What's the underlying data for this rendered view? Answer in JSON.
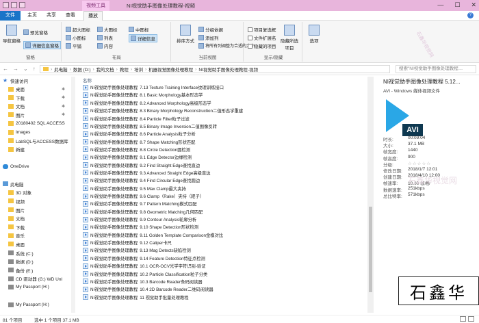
{
  "titlebar": {
    "context_tab": "视频工具",
    "title": "NI视觉助手图像处理教程-视频",
    "minimize": "—",
    "maximize": "☐",
    "close": "✕"
  },
  "tabs": {
    "file": "文件",
    "home": "主页",
    "share": "共享",
    "view": "查看",
    "play": "播放"
  },
  "ribbon": {
    "pane": {
      "nav_pane": "导航窗格",
      "preview": "预览窗格",
      "details": "详细信息窗格",
      "label": "窗格"
    },
    "layout": {
      "xl_icons": "超大图标",
      "large_icons": "大图标",
      "medium_icons": "中图标",
      "small_icons": "小图标",
      "list": "列表",
      "details": "详细信息",
      "tiles": "平铺",
      "content": "内容",
      "label": "布局"
    },
    "view": {
      "sort": "排序方式",
      "group_by": "分组依据",
      "add_columns": "添加列",
      "fit_columns": "将所有列调整为合适的大小",
      "label": "当前视图"
    },
    "showhide": {
      "checkboxes": "项目复选框",
      "extensions": "文件扩展名",
      "hidden": "隐藏的项目",
      "hide_selected": "隐藏所选项目",
      "label": "显示/隐藏"
    },
    "options": "选项"
  },
  "address": {
    "path": [
      "此电脑",
      "数据 (D:)",
      "我的文档",
      "教程",
      "培训",
      "机器视觉图像处理教程",
      "NI视觉助手图像处理教程-视频"
    ],
    "search_placeholder": "搜索\"NI视觉助手图像处理教程…"
  },
  "nav": [
    {
      "label": "快速访问",
      "type": "star",
      "pinned": false
    },
    {
      "label": "桌面",
      "type": "fold",
      "pinned": true
    },
    {
      "label": "下载",
      "type": "fold",
      "pinned": true
    },
    {
      "label": "文档",
      "type": "fold",
      "pinned": true
    },
    {
      "label": "图片",
      "type": "fold",
      "pinned": true
    },
    {
      "label": "20180402 SQL ACCESS",
      "type": "fold",
      "pinned": false
    },
    {
      "label": "Images",
      "type": "fold",
      "pinned": false
    },
    {
      "label": "LabSQL与ACCESS数据库",
      "type": "fold",
      "pinned": false
    },
    {
      "label": "新建",
      "type": "fold",
      "pinned": false
    },
    {
      "label": "",
      "type": "",
      "pinned": false
    },
    {
      "label": "OneDrive",
      "type": "cloud",
      "pinned": false
    },
    {
      "label": "",
      "type": "",
      "pinned": false
    },
    {
      "label": "此电脑",
      "type": "pc",
      "pinned": false
    },
    {
      "label": "3D 对象",
      "type": "fold",
      "pinned": false
    },
    {
      "label": "视频",
      "type": "fold",
      "pinned": false
    },
    {
      "label": "图片",
      "type": "fold",
      "pinned": false
    },
    {
      "label": "文档",
      "type": "fold",
      "pinned": false
    },
    {
      "label": "下载",
      "type": "fold",
      "pinned": false
    },
    {
      "label": "音乐",
      "type": "fold",
      "pinned": false
    },
    {
      "label": "桌面",
      "type": "fold",
      "pinned": false
    },
    {
      "label": "系统 (C:)",
      "type": "drv",
      "pinned": false
    },
    {
      "label": "数据 (D:)",
      "type": "drv",
      "pinned": false
    },
    {
      "label": "备份 (E:)",
      "type": "drv",
      "pinned": false
    },
    {
      "label": "CD 驱动器 (G:) WD Unl",
      "type": "drv",
      "pinned": false
    },
    {
      "label": "My Passport (H:)",
      "type": "drv",
      "pinned": false
    },
    {
      "label": "",
      "type": "",
      "pinned": false
    },
    {
      "label": "My Passport (H:)",
      "type": "drv",
      "pinned": false
    }
  ],
  "list": {
    "header": "名称",
    "prefix": "NI视觉助手图像处理教程",
    "items": [
      "7.13 Texture Training Interface纹理训练接口",
      "8.1 Basic Morphology基本形态学",
      "8.2 Advanced Morphology高级形态学",
      "8.3 Binary Morphology Reconstruction二值形态学重建",
      "8.4 Particle Filter粒子过滤",
      "8.5 Binary Image Inversion二值图像反转",
      "8.6 Particle Analysis粒子分析",
      "8.7 Shape Matching形状匹配",
      "8.8 Circle Detection圆检测",
      "9.1 Edge Detector边缘检测",
      "9.2 Find Straight Edge查找直边",
      "9.3 Advanced Straight Edge高级直边",
      "9.4 Find Circular Edge查找圆边",
      "9.5 Max Clamp最大夹持",
      "9.6 Clamp（Rake）夹持（耙子）",
      "9.7 Pattern Matching模式匹配",
      "9.8 Geometric Matching几何匹配",
      "9.9 Contour Analysis轮廓分析",
      "9.10 Shape Detection形状检测",
      "9.11 Golden Template Comparison金模对比",
      "9.12 Caliper卡尺",
      "9.13 Mag Detects缺陷检测",
      "9.14 Feature Detection特征点检测",
      "10.1 OCR-OCV光学字符识别-验证",
      "10.2 Particle Classification粒子分类",
      "10.3 Barcode Reader条码阅读器",
      "10.4 2D Barcode Reader二维码阅读器",
      "11 视觉助手批量处理教程"
    ]
  },
  "preview": {
    "title": "NI视觉助手图像处理教程 5.12...",
    "subtitle": "AVI - Windows 媒体视频文件",
    "icon_label": "AVI",
    "props": [
      {
        "k": "时长:",
        "v": "00:09:04"
      },
      {
        "k": "大小:",
        "v": "37.1 MB"
      },
      {
        "k": "帧宽度:",
        "v": "1440"
      },
      {
        "k": "帧高度:",
        "v": "900"
      },
      {
        "k": "分级:",
        "v": "☆☆☆☆☆"
      },
      {
        "k": "修改日期:",
        "v": "2018/1/7 12:01"
      },
      {
        "k": "创建日期:",
        "v": "2018/4/10 12:00"
      },
      {
        "k": "帧速率:",
        "v": "10.00 帧/秒"
      },
      {
        "k": "数据速率:",
        "v": "251kbps"
      },
      {
        "k": "总比特率:",
        "v": "571kbps"
      }
    ]
  },
  "watermarks": {
    "side": "石鑫华视觉网",
    "center": "石鑫华视觉网"
  },
  "stamp": "石鑫华",
  "status": {
    "count": "81 个项目",
    "selected": "选中 1 个项目  37.1 MB"
  }
}
